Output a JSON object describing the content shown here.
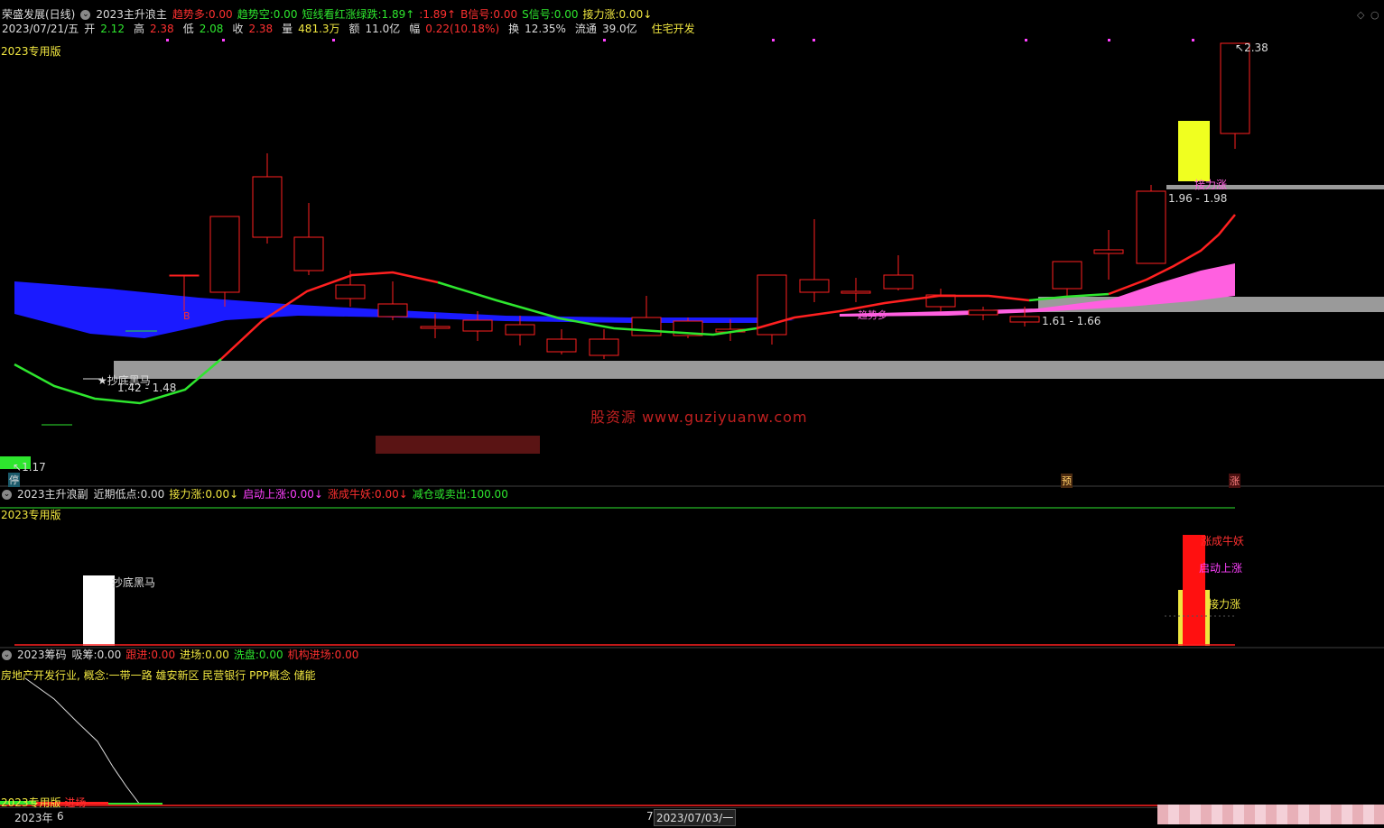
{
  "main_panel": {
    "title_stock": "荣盛发展(日线)",
    "indicator_name": "2023主升浪主",
    "indicators": [
      {
        "label": "趋势多:",
        "value": "0.00",
        "color": "#ff3030"
      },
      {
        "label": "趋势空:",
        "value": "0.00",
        "color": "#2ee62e"
      },
      {
        "label": "短线看红涨绿跌:",
        "value": "1.89",
        "color": "#2ee62e",
        "arrow": "↑"
      },
      {
        "label": ":",
        "value": "1.89",
        "color": "#ff3030",
        "arrow": "↑"
      },
      {
        "label": "B信号:",
        "value": "0.00",
        "color": "#ff3030"
      },
      {
        "label": "S信号:",
        "value": "0.00",
        "color": "#2ee62e"
      },
      {
        "label": "接力涨:",
        "value": "0.00",
        "color": "#f0e640",
        "arrow": "↓"
      }
    ],
    "date": "2023/07/21/五",
    "quote": [
      {
        "label": "开",
        "value": "2.12",
        "color": "#2ee62e"
      },
      {
        "label": "高",
        "value": "2.38",
        "color": "#ff3030"
      },
      {
        "label": "低",
        "value": "2.08",
        "color": "#2ee62e"
      },
      {
        "label": "收",
        "value": "2.38",
        "color": "#ff3030"
      },
      {
        "label": "量",
        "value": "481.3万",
        "color": "#f0e640"
      },
      {
        "label": "额",
        "value": "11.0亿",
        "color": "#dcdcdc"
      },
      {
        "label": "幅",
        "value": "0.22(10.18%)",
        "color": "#ff3030"
      },
      {
        "label": "换",
        "value": "12.35%",
        "color": "#dcdcdc"
      },
      {
        "label": "流通",
        "value": "39.0亿",
        "color": "#dcdcdc"
      },
      {
        "label": "",
        "value": "住宅开发",
        "color": "#f0e640"
      }
    ],
    "version_label": "2023专用版",
    "annotations": {
      "high_price": "2.38",
      "low_price": "1.17",
      "zone_top": "1.96 - 1.98",
      "zone_mid": "1.61 - 1.66",
      "zone_low": "1.42 - 1.48",
      "star_label": "★抄底黑马",
      "relay_label": "接力涨",
      "b_mark": "B",
      "trend_label": "趋势多",
      "stop_tag": "停",
      "pre_tag": "预",
      "rise_tag": "涨"
    },
    "watermark": "股资源 www.guziyuanw.com"
  },
  "sub_panel": {
    "indicator_name": "2023主升浪副",
    "indicators": [
      {
        "label": "近期低点:",
        "value": "0.00",
        "color": "#dcdcdc"
      },
      {
        "label": "接力涨:",
        "value": "0.00",
        "color": "#f0e640",
        "arrow": "↓"
      },
      {
        "label": "启动上涨:",
        "value": "0.00",
        "color": "#ff40ff",
        "arrow": "↓"
      },
      {
        "label": "涨成牛妖:",
        "value": "0.00",
        "color": "#ff3030",
        "arrow": "↓"
      },
      {
        "label": "减仓或卖出:",
        "value": "100.00",
        "color": "#2ee62e"
      }
    ],
    "version_label": "2023专用版",
    "bar_labels": {
      "bottom_horse": "抄底黑马",
      "bull": "涨成牛妖",
      "start": "启动上涨",
      "relay": "接力涨"
    }
  },
  "chip_panel": {
    "indicator_name": "2023筹码",
    "indicators": [
      {
        "label": "吸筹:",
        "value": "0.00",
        "color": "#dcdcdc"
      },
      {
        "label": "跟进:",
        "value": "0.00",
        "color": "#ff3030"
      },
      {
        "label": "进场:",
        "value": "0.00",
        "color": "#f0e640"
      },
      {
        "label": "洗盘:",
        "value": "0.00",
        "color": "#2ee62e"
      },
      {
        "label": "机构进场:",
        "value": "0.00",
        "color": "#ff3030"
      }
    ],
    "concept_line": "房地产开发行业,  概念:一带一路 雄安新区 民营银行 PPP概念 储能",
    "version_label": "2023专用版",
    "entry_label": "进场"
  },
  "time_axis": {
    "labels": [
      "2023年",
      "6",
      "7",
      "2023/07/03/一"
    ]
  },
  "colors": {
    "background": "#000000",
    "up": "#ff3030",
    "down": "#2ee62e",
    "blue_band": "#1a1aff",
    "pink_band": "#ff60e0",
    "yellow": "#f0e640",
    "gray_zone": "#9a9a9a"
  }
}
